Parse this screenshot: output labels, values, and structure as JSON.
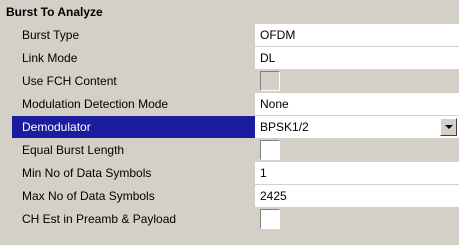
{
  "section": {
    "title": "Burst To Analyze"
  },
  "rows": [
    {
      "label": "Burst Type",
      "value": "OFDM",
      "type": "text"
    },
    {
      "label": "Link Mode",
      "value": "DL",
      "type": "text"
    },
    {
      "label": "Use FCH Content",
      "value": "",
      "type": "checkbox",
      "checked": false,
      "enabled": false
    },
    {
      "label": "Modulation Detection Mode",
      "value": "None",
      "type": "text"
    },
    {
      "label": "Demodulator",
      "value": "BPSK1/2",
      "type": "dropdown",
      "selected": true
    },
    {
      "label": "Equal Burst Length",
      "value": "",
      "type": "checkbox",
      "checked": false,
      "enabled": true
    },
    {
      "label": "Min No of Data Symbols",
      "value": "1",
      "type": "text"
    },
    {
      "label": "Max No of Data Symbols",
      "value": "2425",
      "type": "text"
    },
    {
      "label": "CH Est in Preamb & Payload",
      "value": "",
      "type": "checkbox",
      "checked": false,
      "enabled": true
    }
  ],
  "colors": {
    "panel_bg": "#d4d0c8",
    "selection": "#1c1c9e",
    "field_bg": "#ffffff"
  },
  "icons": {
    "dropdown": "chevron-down-icon"
  }
}
